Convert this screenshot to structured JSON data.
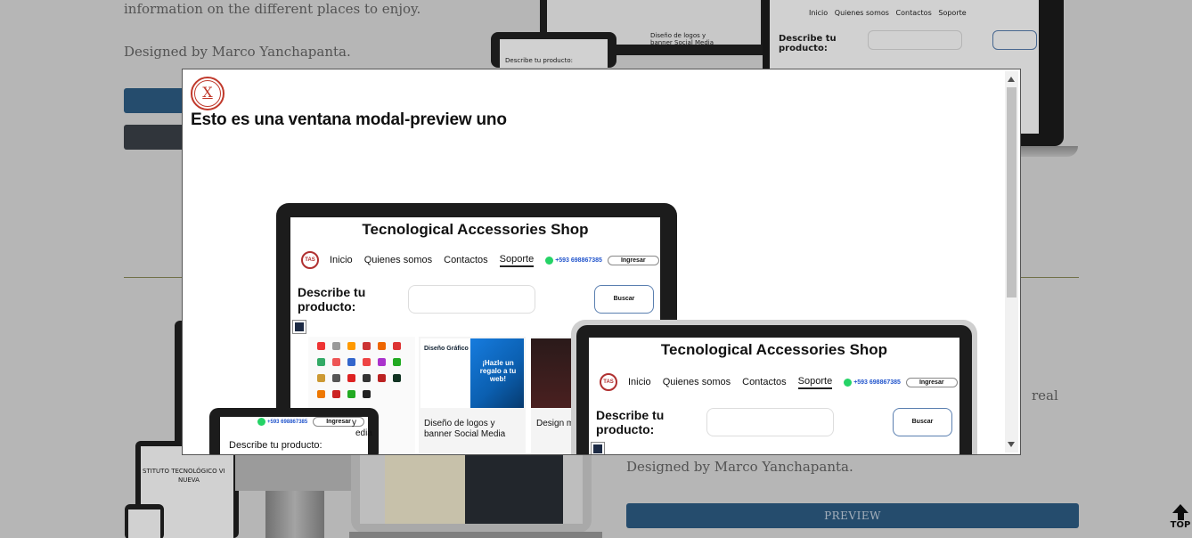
{
  "background": {
    "intro_text": "information on the different places to enjoy.",
    "designer_text": "Designed by Marco Yanchapanta.",
    "designer_text_2": "Designed by Marco Yanchapanta.",
    "partial_word": "real",
    "preview_label": "PREVIEW",
    "top_label": "TOP"
  },
  "modal": {
    "close_label": "X",
    "title": "Esto es una ventana modal-preview uno"
  },
  "mockup": {
    "shop_title": "Tecnological Accessories Shop",
    "logo_text": "TAS",
    "nav": {
      "inicio": "Inicio",
      "quienes": "Quienes somos",
      "contactos": "Contactos",
      "soporte": "Soporte",
      "phone": "+593 698867385",
      "ingresar": "Ingresar"
    },
    "describe": "Describe tu producto:",
    "describe_line1": "Describe tu",
    "describe_line2": "producto:",
    "buscar": "Buscar",
    "card_diseno": "Diseño de logos y banner Social Media",
    "card_diseno_l1": "Diseño de logos y",
    "card_diseno_l2": "banner Social Media",
    "card_design_partial": "Design m",
    "card_media_partial": "edia",
    "card_y_partial": "y",
    "promo_head": "Diseño Gráfico",
    "promo_text": "¡Hazle un regalo a tu web!",
    "institute_text": "STITUTO TECNOLÓGICO VI",
    "institute_text2": "NUEVA"
  },
  "colors": {
    "primary_button": "#2e5d86",
    "secondary_button": "#3b4148",
    "close_accent": "#c0392b"
  }
}
